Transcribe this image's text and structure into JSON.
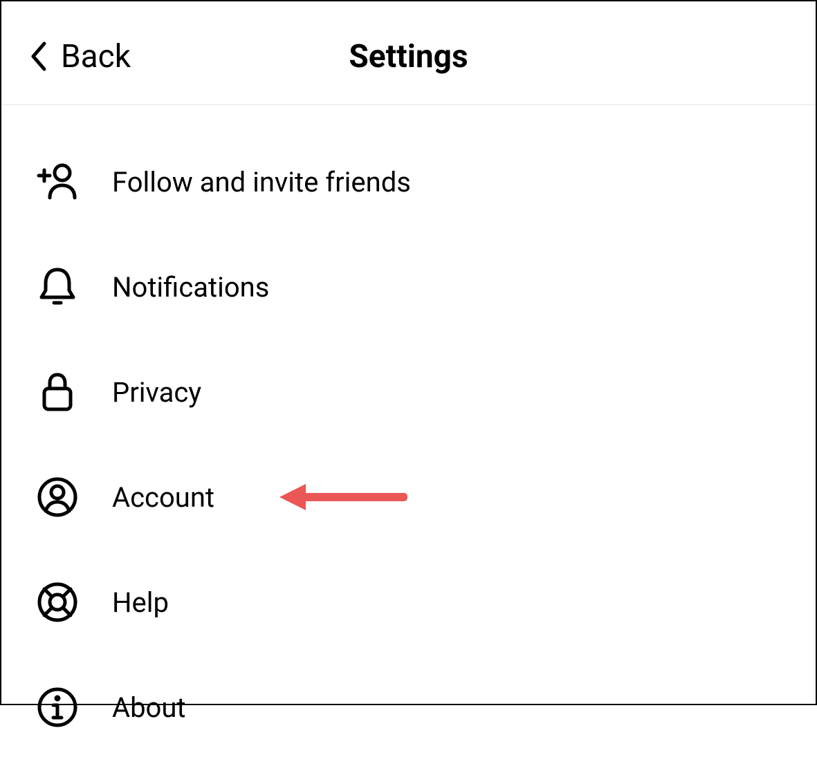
{
  "header": {
    "back_label": "Back",
    "title": "Settings"
  },
  "settings": {
    "items": [
      {
        "label": "Follow and invite friends",
        "icon": "add-person"
      },
      {
        "label": "Notifications",
        "icon": "bell"
      },
      {
        "label": "Privacy",
        "icon": "lock"
      },
      {
        "label": "Account",
        "icon": "account"
      },
      {
        "label": "Help",
        "icon": "lifebuoy"
      },
      {
        "label": "About",
        "icon": "info"
      }
    ]
  },
  "annotation": {
    "arrow_color": "#EB5757",
    "target_index": 3
  }
}
